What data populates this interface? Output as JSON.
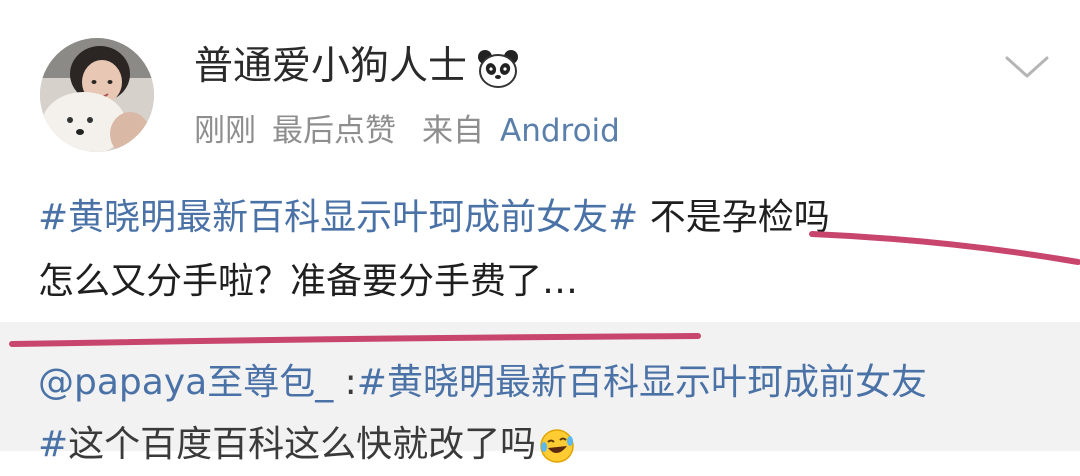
{
  "post": {
    "author": {
      "name": "普通爱小狗人士",
      "name_emoji": "panda-icon"
    },
    "meta": {
      "time": "刚刚",
      "last_liked": "最后点赞",
      "source_prefix": "来自",
      "source_app": "Android"
    },
    "body": {
      "topic": "#黄晓明最新百科显示叶珂成前女友#",
      "line1_rest": " 不是孕检吗",
      "line2": "怎么又分手啦？准备要分手费了…"
    },
    "annotation_color": "#c8456e"
  },
  "repost": {
    "mention": "@papaya至尊包_",
    "separator": " :",
    "topic_part1": "#黄晓明最新百科显示叶珂成前女友",
    "topic_part2": "#",
    "text": "这个百度百科这么快就改了吗",
    "emoji": "laughing-crying-icon"
  },
  "colors": {
    "link_blue": "#4a72a7",
    "meta_gray": "#8e8e8e",
    "repost_bg": "#f2f2f2"
  }
}
